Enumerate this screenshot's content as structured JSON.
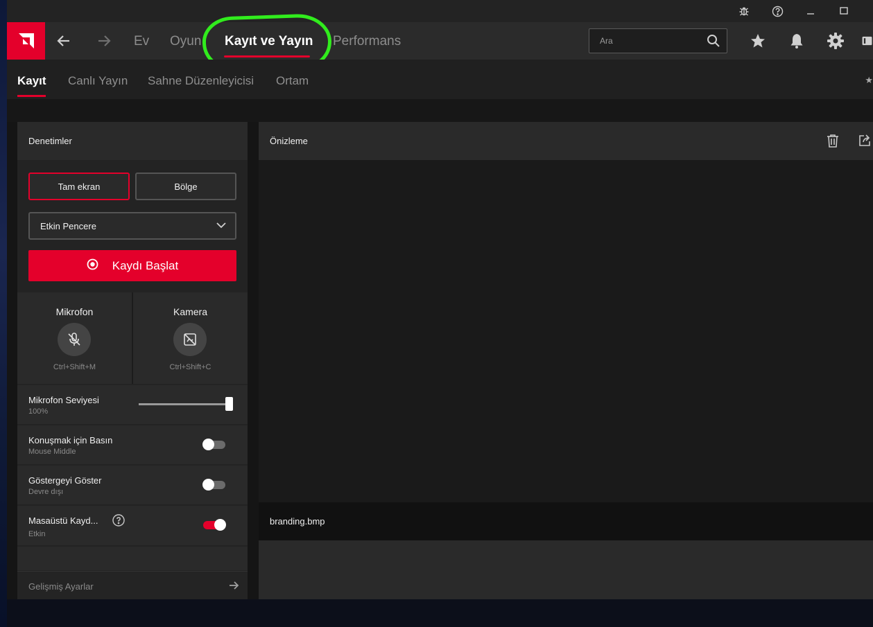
{
  "nav": {
    "links": [
      "Ev",
      "Oyun",
      "Kayıt ve Yayın",
      "Performans"
    ],
    "active_index": 2,
    "search_placeholder": "Ara"
  },
  "subtabs": [
    "Kayıt",
    "Canlı Yayın",
    "Sahne Düzenleyicisi",
    "Ortam"
  ],
  "controls": {
    "title": "Denetimler",
    "fullscreen_label": "Tam ekran",
    "region_label": "Bölge",
    "dropdown_value": "Etkin Pencere",
    "record_label": "Kaydı Başlat",
    "mic": {
      "title": "Mikrofon",
      "shortcut": "Ctrl+Shift+M"
    },
    "camera": {
      "title": "Kamera",
      "shortcut": "Ctrl+Shift+C"
    },
    "mic_level": {
      "title": "Mikrofon Seviyesi",
      "value": "100%",
      "level": 1.0
    },
    "push_to_talk": {
      "title": "Konuşmak için Basın",
      "sub": "Mouse Middle",
      "on": false
    },
    "show_indicator": {
      "title": "Göstergeyi Göster",
      "sub": "Devre dışı",
      "on": false
    },
    "desktop_record": {
      "title": "Masaüstü Kayd...",
      "sub": "Etkin",
      "on": true
    },
    "advanced_label": "Gelişmiş Ayarlar"
  },
  "preview": {
    "title": "Önizleme",
    "file_name": "branding.bmp"
  },
  "colors": {
    "accent": "#e4002b",
    "highlight_annotation": "#31ec1d"
  }
}
